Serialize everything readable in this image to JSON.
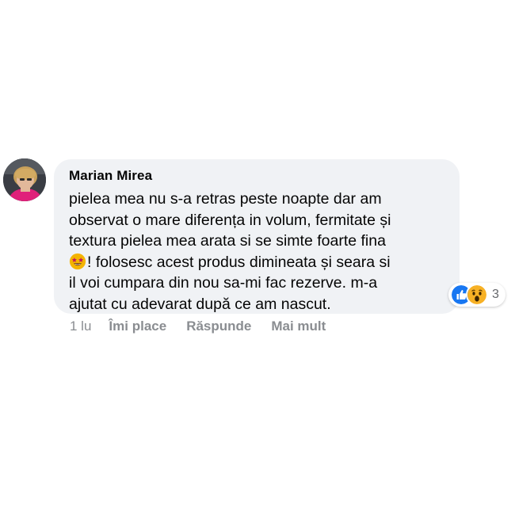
{
  "comment": {
    "author": "Marian Mirea",
    "lines": [
      "pielea mea nu s-a retras peste noapte dar am",
      "observat o mare diferența in volum, fermitate și",
      "textura pielea mea arata si se simte foarte fina",
      "! folosesc acest produs dimineata și seara si",
      "il voi cumpara din nou sa-mi fac rezerve. m-a",
      "ajutat cu adevarat după ce am nascut."
    ],
    "inline_emoji": "star-struck-emoji"
  },
  "reactions": {
    "icons": [
      "like-icon",
      "wow-icon"
    ],
    "count": "3",
    "colors": {
      "like": "#1877f2",
      "wow": "#f7b125"
    }
  },
  "actions": {
    "time": "1 lu",
    "like": "Îmi place",
    "reply": "Răspunde",
    "more": "Mai mult"
  },
  "colors": {
    "bubble": "#f0f2f5",
    "text": "#050505",
    "muted": "#8a8d91"
  }
}
